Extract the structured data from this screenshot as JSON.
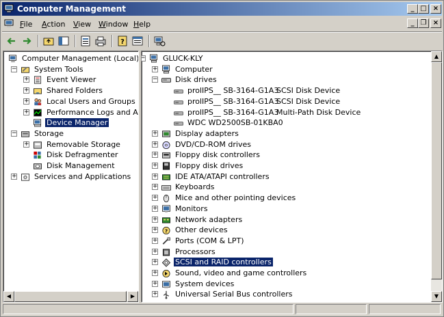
{
  "window": {
    "title": "Computer Management"
  },
  "menu": [
    "File",
    "Action",
    "View",
    "Window",
    "Help"
  ],
  "toolbar": {
    "buttons": [
      "back-icon",
      "forward-icon",
      "up-folder-icon",
      "show-hide-tree-icon",
      "properties-icon",
      "print-icon",
      "help-icon",
      "view-icon",
      "scan-hardware-icon"
    ]
  },
  "left_tree": [
    {
      "label": "Computer Management (Local)",
      "level": 0,
      "icon": "computer-management-icon",
      "expander": "none"
    },
    {
      "label": "System Tools",
      "level": 1,
      "icon": "system-tools-icon",
      "expander": "minus"
    },
    {
      "label": "Event Viewer",
      "level": 2,
      "icon": "event-viewer-icon",
      "expander": "plus"
    },
    {
      "label": "Shared Folders",
      "level": 2,
      "icon": "shared-folders-icon",
      "expander": "plus"
    },
    {
      "label": "Local Users and Groups",
      "level": 2,
      "icon": "users-icon",
      "expander": "plus"
    },
    {
      "label": "Performance Logs and Alerts",
      "level": 2,
      "icon": "performance-icon",
      "expander": "plus"
    },
    {
      "label": "Device Manager",
      "level": 2,
      "icon": "device-manager-icon",
      "expander": "none",
      "selected": true
    },
    {
      "label": "Storage",
      "level": 1,
      "icon": "storage-icon",
      "expander": "minus"
    },
    {
      "label": "Removable Storage",
      "level": 2,
      "icon": "removable-storage-icon",
      "expander": "plus"
    },
    {
      "label": "Disk Defragmenter",
      "level": 2,
      "icon": "defragmenter-icon",
      "expander": "none"
    },
    {
      "label": "Disk Management",
      "level": 2,
      "icon": "disk-management-icon",
      "expander": "none"
    },
    {
      "label": "Services and Applications",
      "level": 1,
      "icon": "services-icon",
      "expander": "plus"
    }
  ],
  "right_tree": [
    {
      "label": "GLUCK-KLY",
      "level": 0,
      "icon": "computer-icon",
      "expander": "minus"
    },
    {
      "label": "Computer",
      "level": 1,
      "icon": "computer-icon",
      "expander": "plus"
    },
    {
      "label": "Disk drives",
      "level": 1,
      "icon": "disk-drive-icon",
      "expander": "minus"
    },
    {
      "label": "prolIPS__ SB-3164-G1A3",
      "desc": "SCSI Disk Device",
      "level": 2,
      "icon": "disk-icon",
      "expander": "none"
    },
    {
      "label": "prolIPS__ SB-3164-G1A3",
      "desc": "SCSI Disk Device",
      "level": 2,
      "icon": "disk-icon",
      "expander": "none"
    },
    {
      "label": "prolIPS__ SB-3164-G1A3",
      "desc": "Multi-Path Disk Device",
      "level": 2,
      "icon": "disk-icon",
      "expander": "none"
    },
    {
      "label": "WDC WD2500SB-01KBA0",
      "desc": "",
      "level": 2,
      "icon": "disk-icon",
      "expander": "none"
    },
    {
      "label": "Display adapters",
      "level": 1,
      "icon": "display-icon",
      "expander": "plus"
    },
    {
      "label": "DVD/CD-ROM drives",
      "level": 1,
      "icon": "cdrom-icon",
      "expander": "plus"
    },
    {
      "label": "Floppy disk controllers",
      "level": 1,
      "icon": "floppy-controller-icon",
      "expander": "plus"
    },
    {
      "label": "Floppy disk drives",
      "level": 1,
      "icon": "floppy-icon",
      "expander": "plus"
    },
    {
      "label": "IDE ATA/ATAPI controllers",
      "level": 1,
      "icon": "ide-icon",
      "expander": "plus"
    },
    {
      "label": "Keyboards",
      "level": 1,
      "icon": "keyboard-icon",
      "expander": "plus"
    },
    {
      "label": "Mice and other pointing devices",
      "level": 1,
      "icon": "mouse-icon",
      "expander": "plus"
    },
    {
      "label": "Monitors",
      "level": 1,
      "icon": "monitor-icon",
      "expander": "plus"
    },
    {
      "label": "Network adapters",
      "level": 1,
      "icon": "network-icon",
      "expander": "plus"
    },
    {
      "label": "Other devices",
      "level": 1,
      "icon": "other-devices-icon",
      "expander": "plus"
    },
    {
      "label": "Ports (COM & LPT)",
      "level": 1,
      "icon": "ports-icon",
      "expander": "plus"
    },
    {
      "label": "Processors",
      "level": 1,
      "icon": "processor-icon",
      "expander": "plus"
    },
    {
      "label": "SCSI and RAID controllers",
      "level": 1,
      "icon": "scsi-icon",
      "expander": "plus",
      "selected": true
    },
    {
      "label": "Sound, video and game controllers",
      "level": 1,
      "icon": "sound-icon",
      "expander": "plus"
    },
    {
      "label": "System devices",
      "level": 1,
      "icon": "system-devices-icon",
      "expander": "plus"
    },
    {
      "label": "Universal Serial Bus controllers",
      "level": 1,
      "icon": "usb-icon",
      "expander": "plus"
    }
  ],
  "colors": {
    "title_start": "#0a246a",
    "title_end": "#a6caf0",
    "selection": "#0a246a",
    "chrome": "#d4d0c8"
  }
}
